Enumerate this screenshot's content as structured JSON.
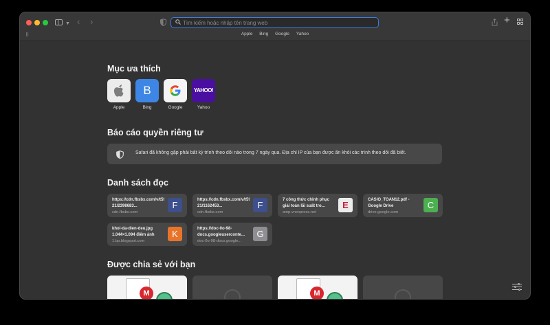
{
  "address_bar": {
    "placeholder": "Tìm kiếm hoặc nhập tên trang web"
  },
  "bookmarks_bar": [
    "Apple",
    "Bing",
    "Google",
    "Yahoo"
  ],
  "favorites": {
    "title": "Mục ưa thích",
    "items": [
      {
        "label": "Apple",
        "icon": "apple-logo-icon"
      },
      {
        "label": "Bing",
        "icon_text": "B"
      },
      {
        "label": "Google",
        "icon": "google-logo-icon"
      },
      {
        "label": "Yahoo",
        "icon_text": "YAHOO!"
      }
    ]
  },
  "privacy_report": {
    "title": "Báo cáo quyền riêng tư",
    "text": "Safari đã không gặp phải bất kỳ trình theo dõi nào trong 7 ngày qua. Địa chỉ IP của bạn được ẩn khỏi các trình theo dõi đã biết."
  },
  "reading_list": {
    "title": "Danh sách đọc",
    "items": [
      {
        "title": "https://cdn.fbsbx.com/v/t59.2708-21/2398683...",
        "domain": "cdn.fbsbx.com",
        "thumb": "F",
        "color": "#3d4f8c"
      },
      {
        "title": "https://cdn.fbsbx.com/v/t59.2708-21/1162453...",
        "domain": "cdn.fbsbx.com",
        "thumb": "F",
        "color": "#3d4f8c"
      },
      {
        "title": "7 công thức chinh phục giải toán lãi suất tro...",
        "domain": "amp.vnexpress.net",
        "thumb": "E",
        "color": "#ececec"
      },
      {
        "title": "CASIO_TOAN12.pdf - Google Drive",
        "domain": "drive.google.com",
        "thumb": "C",
        "color": "#4caf50"
      },
      {
        "title": "khoi-da-dien-deu.jpg 1.044×1.094 điểm ảnh",
        "domain": "1.bp.blogspot.com",
        "thumb": "K",
        "color": "#e8742c"
      },
      {
        "title": "https://doc-0o-98-docs.googleuserconte...",
        "domain": "doc-0o-98-docs.google...",
        "thumb": "G",
        "color": "#8e8e93"
      }
    ]
  },
  "shared_with_you": {
    "title": "Được chia sẻ với bạn"
  },
  "colors": {
    "accent": "#3b7de0",
    "background": "#323232",
    "card": "#474747"
  }
}
